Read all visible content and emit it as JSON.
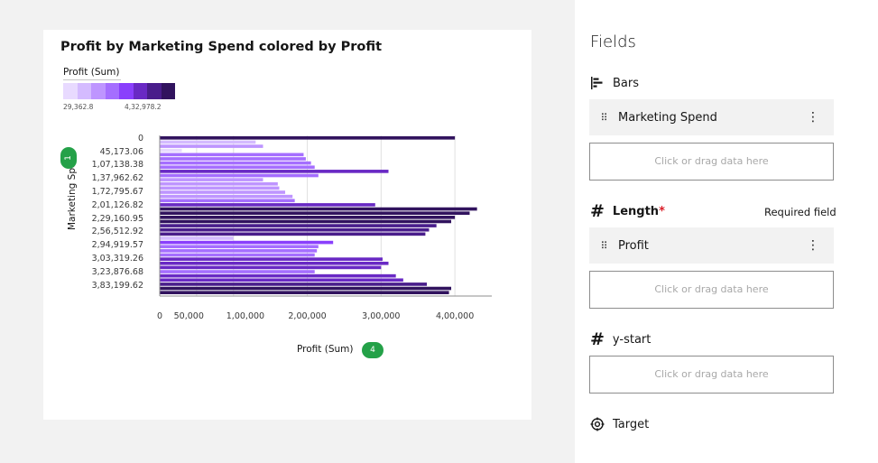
{
  "chart_data": {
    "type": "bar",
    "orientation": "horizontal",
    "title": "Profit by Marketing Spend colored by Profit",
    "xlabel": "Profit (Sum)",
    "ylabel": "Marketing Spend",
    "xlim": [
      0,
      450000
    ],
    "x_ticks": [
      "0",
      "50,000",
      "1,00,000",
      "2,00,000",
      "3,00,000",
      "4,00,000"
    ],
    "x_tick_values": [
      0,
      50000,
      100000,
      200000,
      300000,
      400000
    ],
    "y_ticks": [
      "0",
      "45,173.06",
      "1,07,138.38",
      "1,37,962.62",
      "1,72,795.67",
      "2,01,126.82",
      "2,29,160.95",
      "2,56,512.92",
      "2,94,919.57",
      "3,03,319.26",
      "3,23,876.68",
      "3,83,199.62"
    ],
    "values": [
      400000,
      130000,
      140000,
      30000,
      195000,
      198000,
      205000,
      210000,
      310000,
      215000,
      140000,
      160000,
      162000,
      170000,
      180000,
      183000,
      292000,
      430000,
      420000,
      400000,
      395000,
      375000,
      365000,
      360000,
      100000,
      235000,
      215000,
      213000,
      210000,
      302000,
      310000,
      300000,
      210000,
      320000,
      330000,
      362000,
      395000,
      392000
    ],
    "legend": {
      "title": "Profit (Sum)",
      "min": "29,362.8",
      "max": "4,32,978.2",
      "colors": [
        "#e8daff",
        "#d4bbff",
        "#be95ff",
        "#a56eff",
        "#8a3ffc",
        "#6929c4",
        "#491d8b",
        "#31135e"
      ]
    },
    "grid": true
  },
  "x_pill": "4",
  "y_pill": "1",
  "panel": {
    "title": "Fields",
    "bars_label": "Bars",
    "bars_field": "Marketing Spend",
    "length_label": "Length",
    "length_star": "*",
    "required_note": "Required field",
    "length_field": "Profit",
    "ystart_label": "y-start",
    "target_label": "Target",
    "drop_text": "Click or drag data here"
  },
  "icons": {
    "bars": "bar-chart-icon",
    "hash": "hash-icon",
    "target": "target-icon",
    "grip": "drag-handle-icon",
    "kebab": "overflow-menu-icon"
  }
}
